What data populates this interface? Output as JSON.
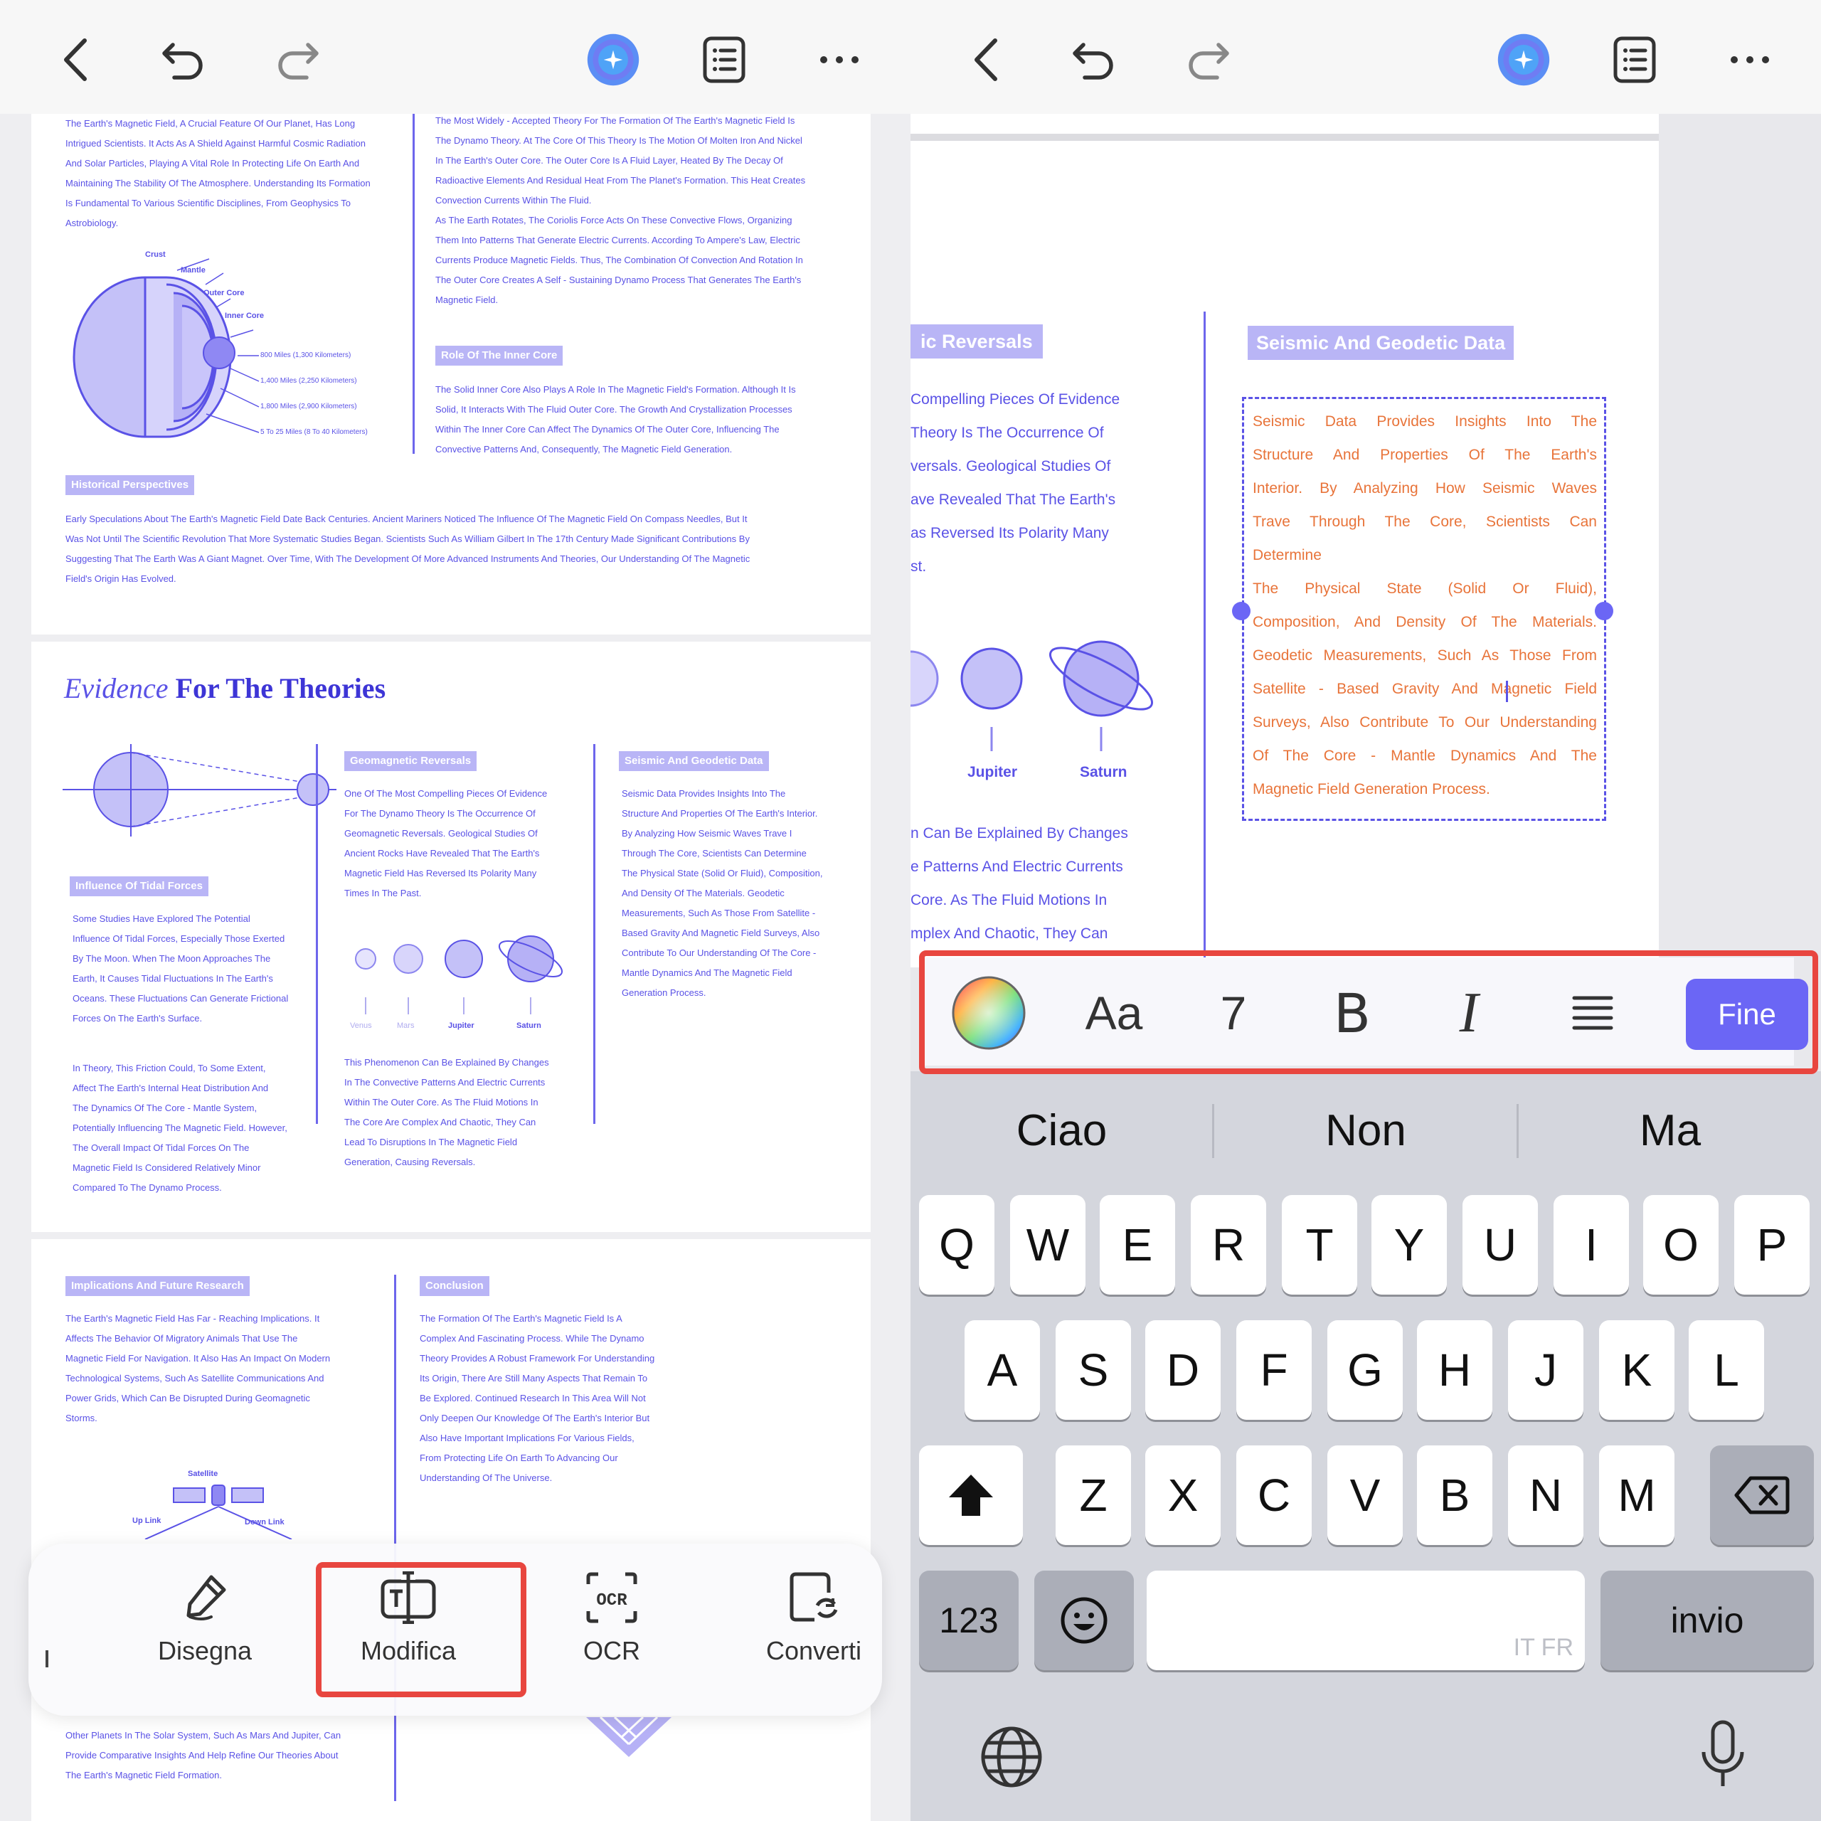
{
  "left": {
    "pdf": {
      "page1": {
        "intro": [
          "The Earth's Magnetic Field, A Crucial Feature Of Our Planet, Has Long",
          "Intrigued Scientists. It Acts As A Shield Against Harmful Cosmic Radiation",
          "And Solar Particles, Playing A Vital Role In Protecting Life On Earth And",
          "Maintaining The Stability Of The Atmosphere. Understanding Its Formation",
          "Is Fundamental To Various Scientific Disciplines, From Geophysics To",
          "Astrobiology."
        ],
        "dynamo": [
          "The Most Widely - Accepted Theory For The Formation Of The Earth's Magnetic Field Is",
          "The Dynamo Theory. At The Core Of This Theory Is The Motion Of Molten Iron And Nickel",
          "In The Earth's Outer Core. The Outer Core Is A Fluid Layer, Heated By The Decay Of",
          "Radioactive Elements And Residual Heat From The Planet's Formation. This Heat Creates",
          "Convection Currents Within The Fluid.",
          "As The Earth Rotates, The Coriolis Force Acts On These Convective Flows, Organizing",
          "Them Into Patterns That Generate Electric Currents. According To Ampere's Law, Electric",
          "Currents Produce Magnetic Fields. Thus, The Combination Of Convection And Rotation In",
          "The Outer Core Creates A Self - Sustaining Dynamo Process That Generates The Earth's",
          "Magnetic Field."
        ],
        "diagram_labels": {
          "crust": "Crust",
          "mantle": "Mantle",
          "outer_core": "Outer Core",
          "inner_core": "Inner Core",
          "d1": "800 Miles (1,300 Kilometers)",
          "d2": "1,400 Miles (2,250 Kilometers)",
          "d3": "1,800 Miles (2,900 Kilometers)",
          "d4": "5 To 25 Miles (8 To 40 Kilometers)"
        },
        "inner_core_title": "Role Of The Inner Core",
        "inner_core": [
          "The Solid Inner Core Also Plays A Role In The Magnetic Field's Formation. Although It Is",
          "Solid, It Interacts With The Fluid Outer Core. The Growth And Crystallization Processes",
          "Within The Inner Core Can Affect The Dynamics Of The Outer Core, Influencing The",
          "Convective Patterns And, Consequently, The Magnetic Field Generation."
        ],
        "historical_title": "Historical Perspectives",
        "historical": [
          "Early Speculations About The Earth's Magnetic Field Date Back Centuries. Ancient Mariners Noticed The Influence Of The Magnetic Field On Compass Needles, But It",
          "Was Not Until The Scientific Revolution That More Systematic Studies Began. Scientists Such As William Gilbert In The 17th Century Made Significant Contributions By",
          "Suggesting That The Earth Was A Giant Magnet. Over Time, With The Development Of More Advanced Instruments And Theories, Our Understanding Of The Magnetic",
          "Field's Origin Has Evolved."
        ]
      },
      "page2": {
        "title_italic": "Evidence",
        "title_rest": "For The Theories",
        "tidal_title": "Influence Of Tidal Forces",
        "tidal": [
          "Some Studies Have Explored The Potential",
          "Influence Of Tidal Forces, Especially Those Exerted",
          "By The Moon. When The Moon Approaches The",
          "Earth, It Causes Tidal Fluctuations In The Earth's",
          "Oceans. These Fluctuations Can Generate Frictional",
          "Forces On The Earth's Surface."
        ],
        "friction": [
          " In Theory, This Friction Could, To Some Extent,",
          "Affect The Earth's Internal Heat Distribution And",
          "The Dynamics Of The Core - Mantle System,",
          "Potentially Influencing The Magnetic Field. However,",
          "The Overall Impact Of Tidal Forces On The",
          "Magnetic Field Is Considered Relatively Minor",
          "Compared To The Dynamo Process."
        ],
        "geo_title": "Geomagnetic Reversals",
        "geo": [
          "One Of The Most Compelling Pieces Of Evidence",
          "For The Dynamo Theory Is The Occurrence Of",
          "Geomagnetic Reversals. Geological Studies Of",
          "Ancient Rocks Have Revealed That The Earth's",
          "Magnetic Field Has Reversed Its Polarity Many",
          "Times In The Past."
        ],
        "planets": [
          "Venus",
          "Mars",
          "Jupiter",
          "Saturn"
        ],
        "phenomenon": [
          "This Phenomenon Can Be Explained By Changes",
          "In The Convective Patterns And Electric Currents",
          "Within The Outer Core. As The Fluid Motions In",
          "The Core Are Complex And Chaotic, They Can",
          "Lead To Disruptions In The Magnetic Field",
          "Generation, Causing Reversals."
        ],
        "seismic_title": "Seismic And Geodetic Data",
        "seismic": [
          "Seismic Data Provides Insights Into The",
          "Structure And Properties Of The Earth's Interior.",
          "By Analyzing How Seismic Waves Trave I",
          "Through The Core, Scientists Can Determine",
          "The Physical State (Solid Or Fluid), Composition,",
          "And Density Of The Materials. Geodetic",
          "Measurements, Such As Those From Satellite -",
          "Based Gravity And Magnetic Field Surveys, Also",
          "Contribute To Our Understanding Of The Core -",
          "Mantle Dynamics And The Magnetic Field",
          "Generation Process."
        ]
      },
      "page3": {
        "impl_title": "Implications And Future Research",
        "impl": [
          "The Earth's Magnetic Field Has Far - Reaching Implications. It",
          "Affects The Behavior Of Migratory Animals That Use The",
          "Magnetic Field For Navigation. It Also Has An Impact On Modern",
          "Technological Systems, Such As Satellite Communications And",
          "Power Grids, Which Can Be Disrupted During Geomagnetic",
          "Storms."
        ],
        "satellite": "Satellite",
        "uplink": "Up Link",
        "downlink": "Down Link",
        "concl_title": "Conclusion",
        "concl": [
          "The Formation Of The Earth's Magnetic Field Is A",
          "Complex And Fascinating Process. While The Dynamo",
          "Theory Provides A Robust Framework For Understanding",
          "Its Origin, There Are Still Many Aspects That Remain To",
          "Be Explored. Continued Research In This Area Will Not",
          "Only Deepen Our Knowledge Of The Earth's Interior But",
          "Also Have Important Implications For Various Fields,",
          "From Protecting Life On Earth To Advancing Our",
          "Understanding Of The Universe."
        ],
        "bottom": [
          "Other Planets In The Solar System, Such As Mars And Jupiter, Can",
          "Provide Comparative Insights And Help Refine Our Theories About",
          "The Earth's Magnetic Field Formation."
        ]
      }
    },
    "tools": {
      "draw": "Disegna",
      "edit": "Modifica",
      "ocr": "OCR",
      "convert": "Converti"
    }
  },
  "right": {
    "reversals_title": "ic Reversals",
    "reversals": [
      "Compelling Pieces Of Evidence",
      "Theory Is The Occurrence Of",
      "versals. Geological Studies Of",
      "ave Revealed That The Earth's",
      "as Reversed Its Polarity Many",
      "st."
    ],
    "planets": [
      "Jupiter",
      "Saturn"
    ],
    "phenomenon": [
      "n Can Be Explained By Changes",
      "e Patterns And Electric Currents",
      "Core. As The Fluid Motions In",
      "mplex And Chaotic, They Can"
    ],
    "seismic_title": "Seismic And Geodetic Data",
    "seismic": [
      "Seismic Data Provides Insights Into The",
      "Structure And Properties Of The Earth's",
      "Interior. By Analyzing How Seismic Waves",
      "Trave Through The Core, Scientists Can",
      "Determine",
      "The Physical State (Solid Or Fluid),",
      "Composition, And Density Of The Materials.",
      "Geodetic Measurements, Such As Those From",
      "Satellite - Based Gravity And Magnetic Field",
      "Surveys, Also Contribute To Our Understanding",
      "Of The Core - Mantle Dynamics And The",
      "Magnetic Field Generation Process."
    ],
    "format": {
      "font": "Aa",
      "size": "7",
      "bold": "B",
      "italic": "I",
      "done": "Fine"
    },
    "suggestions": [
      "Ciao",
      "Non",
      "Ma"
    ],
    "keys": {
      "row1": [
        "Q",
        "W",
        "E",
        "R",
        "T",
        "Y",
        "U",
        "I",
        "O",
        "P"
      ],
      "row2": [
        "A",
        "S",
        "D",
        "F",
        "G",
        "H",
        "J",
        "K",
        "L"
      ],
      "row3": [
        "Z",
        "X",
        "C",
        "V",
        "B",
        "N",
        "M"
      ],
      "numbers": "123",
      "return": "invio",
      "space_hint": "IT FR"
    }
  },
  "colors": {
    "accent": "#5a52e6",
    "chip": "#b9b5f6",
    "selected_text": "#e8743a",
    "highlight_box": "#e8463f",
    "done_button": "#6b66f5"
  }
}
